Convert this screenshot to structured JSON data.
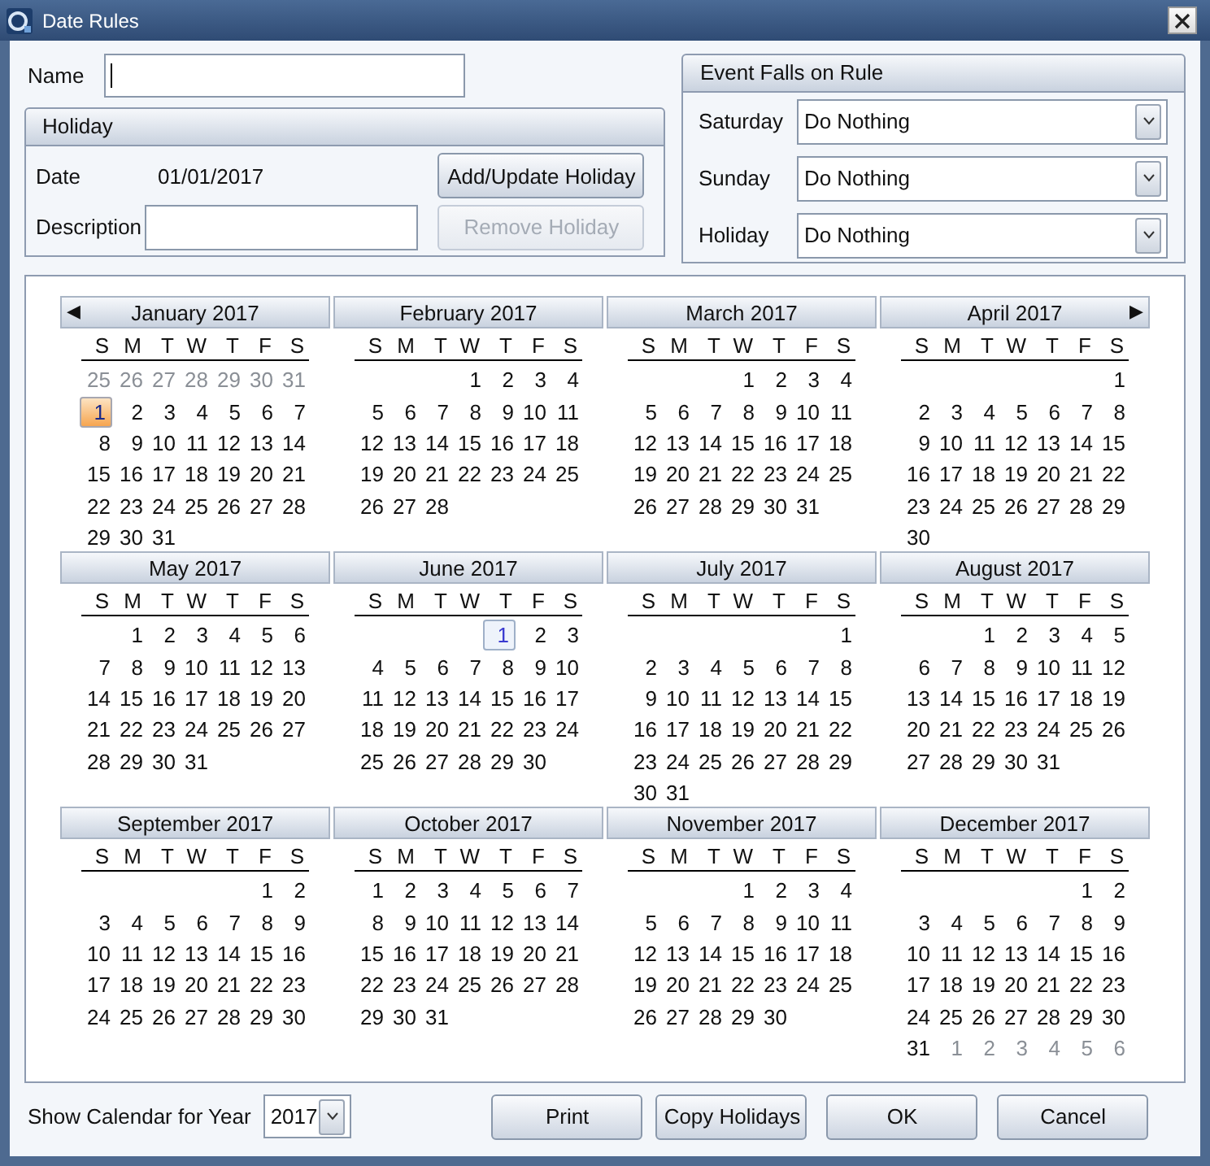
{
  "window": {
    "title": "Date Rules"
  },
  "name_field": {
    "label": "Name"
  },
  "holiday": {
    "title": "Holiday",
    "date_label": "Date",
    "date_value": "01/01/2017",
    "description_label": "Description",
    "buttons": [
      {
        "label": "Add/Update Holiday",
        "disabled": false
      },
      {
        "label": "Remove Holiday",
        "disabled": true
      }
    ]
  },
  "event_rule": {
    "title": "Event Falls on Rule",
    "rows": [
      {
        "label": "Saturday",
        "value": "Do Nothing"
      },
      {
        "label": "Sunday",
        "value": "Do Nothing"
      },
      {
        "label": "Holiday",
        "value": "Do Nothing"
      }
    ]
  },
  "calendar": {
    "months": [
      {
        "title": "January 2017",
        "prev_arrow": "◀",
        "weekdays": [
          "S",
          "M",
          "T",
          "W",
          "T",
          "F",
          "S"
        ],
        "prev_days": [
          "25",
          "26",
          "27",
          "28",
          "29",
          "30",
          "31"
        ],
        "days": [
          {
            "day": "1",
            "selected": true,
            "highlighted": false
          },
          "2",
          "3",
          "4",
          "5",
          "6",
          "7",
          "8",
          "9",
          "10",
          "11",
          "12",
          "13",
          "14",
          "15",
          "16",
          "17",
          "18",
          "19",
          "20",
          "21",
          "22",
          "23",
          "24",
          "25",
          "26",
          "27",
          "28",
          "29",
          "30",
          "31"
        ]
      },
      {
        "title": "February 2017",
        "weekdays": [
          "S",
          "M",
          "T",
          "W",
          "T",
          "F",
          "S"
        ],
        "days": [
          "1",
          "2",
          "3",
          "4",
          "5",
          "6",
          "7",
          "8",
          "9",
          "10",
          "11",
          "12",
          "13",
          "14",
          "15",
          "16",
          "17",
          "18",
          "19",
          "20",
          "21",
          "22",
          "23",
          "24",
          "25",
          "26",
          "27",
          "28"
        ]
      },
      {
        "title": "March 2017",
        "weekdays": [
          "S",
          "M",
          "T",
          "W",
          "T",
          "F",
          "S"
        ],
        "days": [
          "1",
          "2",
          "3",
          "4",
          "5",
          "6",
          "7",
          "8",
          "9",
          "10",
          "11",
          "12",
          "13",
          "14",
          "15",
          "16",
          "17",
          "18",
          "19",
          "20",
          "21",
          "22",
          "23",
          "24",
          "25",
          "26",
          "27",
          "28",
          "29",
          "30",
          "31"
        ]
      },
      {
        "title": "April 2017",
        "next_arrow": "▶",
        "weekdays": [
          "S",
          "M",
          "T",
          "W",
          "T",
          "F",
          "S"
        ],
        "days": [
          "1",
          "2",
          "3",
          "4",
          "5",
          "6",
          "7",
          "8",
          "9",
          "10",
          "11",
          "12",
          "13",
          "14",
          "15",
          "16",
          "17",
          "18",
          "19",
          "20",
          "21",
          "22",
          "23",
          "24",
          "25",
          "26",
          "27",
          "28",
          "29",
          "30"
        ]
      },
      {
        "title": "May 2017",
        "weekdays": [
          "S",
          "M",
          "T",
          "W",
          "T",
          "F",
          "S"
        ],
        "days": [
          "1",
          "2",
          "3",
          "4",
          "5",
          "6",
          "7",
          "8",
          "9",
          "10",
          "11",
          "12",
          "13",
          "14",
          "15",
          "16",
          "17",
          "18",
          "19",
          "20",
          "21",
          "22",
          "23",
          "24",
          "25",
          "26",
          "27",
          "28",
          "29",
          "30",
          "31"
        ]
      },
      {
        "title": "June 2017",
        "weekdays": [
          "S",
          "M",
          "T",
          "W",
          "T",
          "F",
          "S"
        ],
        "days": [
          {
            "day": "1",
            "selected": false,
            "highlighted": true
          },
          "2",
          "3",
          "4",
          "5",
          "6",
          "7",
          "8",
          "9",
          "10",
          "11",
          "12",
          "13",
          "14",
          "15",
          "16",
          "17",
          "18",
          "19",
          "20",
          "21",
          "22",
          "23",
          "24",
          "25",
          "26",
          "27",
          "28",
          "29",
          "30"
        ]
      },
      {
        "title": "July 2017",
        "weekdays": [
          "S",
          "M",
          "T",
          "W",
          "T",
          "F",
          "S"
        ],
        "days": [
          "1",
          "2",
          "3",
          "4",
          "5",
          "6",
          "7",
          "8",
          "9",
          "10",
          "11",
          "12",
          "13",
          "14",
          "15",
          "16",
          "17",
          "18",
          "19",
          "20",
          "21",
          "22",
          "23",
          "24",
          "25",
          "26",
          "27",
          "28",
          "29",
          "30",
          "31"
        ]
      },
      {
        "title": "August 2017",
        "weekdays": [
          "S",
          "M",
          "T",
          "W",
          "T",
          "F",
          "S"
        ],
        "days": [
          "1",
          "2",
          "3",
          "4",
          "5",
          "6",
          "7",
          "8",
          "9",
          "10",
          "11",
          "12",
          "13",
          "14",
          "15",
          "16",
          "17",
          "18",
          "19",
          "20",
          "21",
          "22",
          "23",
          "24",
          "25",
          "26",
          "27",
          "28",
          "29",
          "30",
          "31"
        ]
      },
      {
        "title": "September 2017",
        "weekdays": [
          "S",
          "M",
          "T",
          "W",
          "T",
          "F",
          "S"
        ],
        "days": [
          "1",
          "2",
          "3",
          "4",
          "5",
          "6",
          "7",
          "8",
          "9",
          "10",
          "11",
          "12",
          "13",
          "14",
          "15",
          "16",
          "17",
          "18",
          "19",
          "20",
          "21",
          "22",
          "23",
          "24",
          "25",
          "26",
          "27",
          "28",
          "29",
          "30"
        ]
      },
      {
        "title": "October 2017",
        "weekdays": [
          "S",
          "M",
          "T",
          "W",
          "T",
          "F",
          "S"
        ],
        "days": [
          "1",
          "2",
          "3",
          "4",
          "5",
          "6",
          "7",
          "8",
          "9",
          "10",
          "11",
          "12",
          "13",
          "14",
          "15",
          "16",
          "17",
          "18",
          "19",
          "20",
          "21",
          "22",
          "23",
          "24",
          "25",
          "26",
          "27",
          "28",
          "29",
          "30",
          "31"
        ]
      },
      {
        "title": "November 2017",
        "weekdays": [
          "S",
          "M",
          "T",
          "W",
          "T",
          "F",
          "S"
        ],
        "days": [
          "1",
          "2",
          "3",
          "4",
          "5",
          "6",
          "7",
          "8",
          "9",
          "10",
          "11",
          "12",
          "13",
          "14",
          "15",
          "16",
          "17",
          "18",
          "19",
          "20",
          "21",
          "22",
          "23",
          "24",
          "25",
          "26",
          "27",
          "28",
          "29",
          "30"
        ]
      },
      {
        "title": "December 2017",
        "weekdays": [
          "S",
          "M",
          "T",
          "W",
          "T",
          "F",
          "S"
        ],
        "days": [
          "1",
          "2",
          "3",
          "4",
          "5",
          "6",
          "7",
          "8",
          "9",
          "10",
          "11",
          "12",
          "13",
          "14",
          "15",
          "16",
          "17",
          "18",
          "19",
          "20",
          "21",
          "22",
          "23",
          "24",
          "25",
          "26",
          "27",
          "28",
          "29",
          "30",
          "31"
        ],
        "next_days": [
          "1",
          "2",
          "3",
          "4",
          "5",
          "6"
        ]
      }
    ]
  },
  "footer": {
    "year_label": "Show Calendar for Year",
    "year_value": "2017",
    "buttons": [
      {
        "label": "Print"
      },
      {
        "label": "Copy Holidays"
      },
      {
        "label": "OK"
      },
      {
        "label": "Cancel"
      }
    ]
  }
}
